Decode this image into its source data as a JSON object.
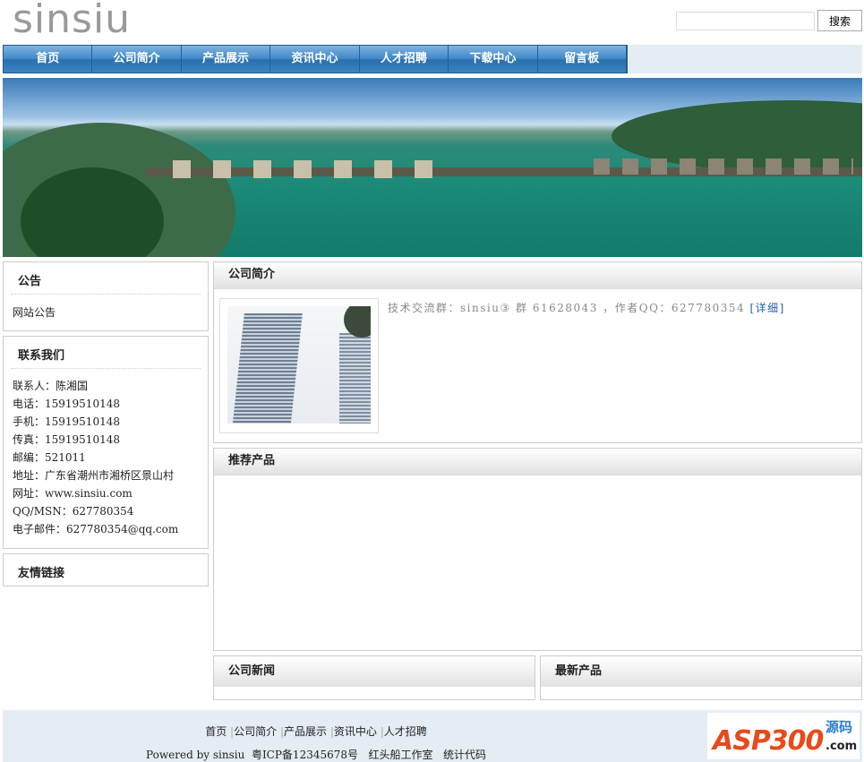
{
  "header": {
    "logo": "sinsiu",
    "search_placeholder": "",
    "search_button": "搜索"
  },
  "nav": [
    "首页",
    "公司简介",
    "产品展示",
    "资讯中心",
    "人才招聘",
    "下载中心",
    "留言板"
  ],
  "sidebar": {
    "notice": {
      "title": "公告",
      "text": "网站公告"
    },
    "contact": {
      "title": "联系我们",
      "lines": [
        "联系人：陈湘国",
        "电话：15919510148",
        "手机：15919510148",
        "传真：15919510148",
        "邮编：521011",
        "地址：广东省潮州市湘桥区景山村",
        "网址：www.sinsiu.com",
        "QQ/MSN：627780354",
        "电子邮件：627780354@qq.com"
      ]
    },
    "links": {
      "title": "友情链接"
    }
  },
  "main": {
    "intro": {
      "title": "公司简介",
      "text": "技术交流群：sinsiu③ 群 61628043 ，作者QQ：627780354",
      "more": "[详细]"
    },
    "products": {
      "title": "推荐产品"
    },
    "news": {
      "title": "公司新闻"
    },
    "latest": {
      "title": "最新产品"
    }
  },
  "footer": {
    "links": [
      "首页",
      "公司简介",
      "产品展示",
      "资讯中心",
      "人才招聘"
    ],
    "separator": "|",
    "powered": "Powered by sinsiu",
    "icp": "粤ICP备12345678号",
    "studio": "红头船工作室",
    "stats": "统计代码",
    "badge": "ASP300",
    "badge_sub": "源码",
    "badge_dom": ".com"
  }
}
